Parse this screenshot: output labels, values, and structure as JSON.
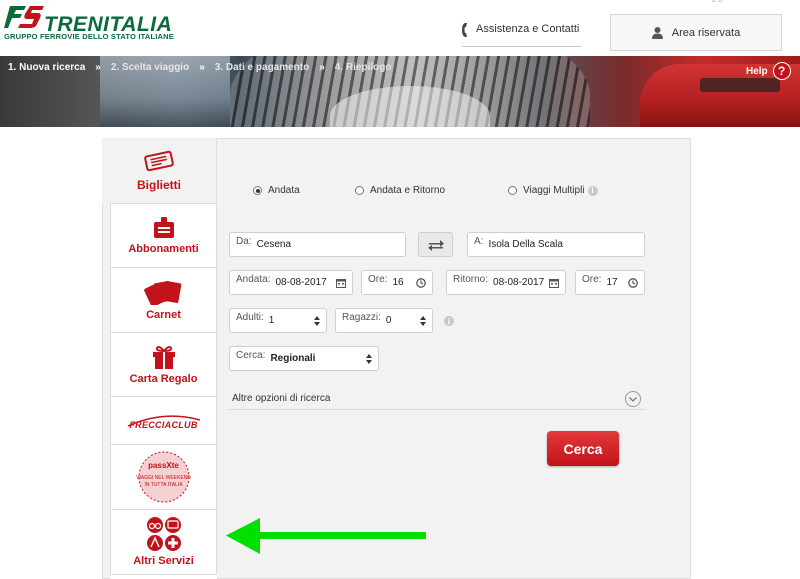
{
  "header": {
    "brand": "TRENITALIA",
    "brand_sub": "GRUPPO FERROVIE DELLO STATO ITALIANE",
    "assist_label": "Assistenza e Contatti",
    "area_label": "Area riservata"
  },
  "steps": [
    {
      "label": "1. Nuova ricerca"
    },
    {
      "label": "2. Scelta viaggio"
    },
    {
      "label": "3. Dati e pagamento"
    },
    {
      "label": "4. Riepilogo"
    }
  ],
  "step_separator": "»",
  "help_label": "Help",
  "help_icon": "?",
  "tabs": {
    "biglietti": "Biglietti",
    "abbonamenti": "Abbonamenti",
    "carnet": "Carnet",
    "carta_regalo": "Carta Regalo",
    "frecciaclub": "FRECCIACLUB",
    "passxte_title": "passXte",
    "passxte_sub": "VIAGGI NEL WEEKEND IN TUTTA ITALIA",
    "altri_servizi": "Altri Servizi"
  },
  "trip_type": {
    "options": [
      "Andata",
      "Andata e Ritorno",
      "Viaggi Multipli"
    ],
    "selected": "Andata"
  },
  "form": {
    "from_label": "Da:",
    "from_value": "Cesena",
    "to_label": "A:",
    "to_value": "Isola Della Scala",
    "andata_label": "Andata:",
    "andata_value": "08-08-2017",
    "ore1_label": "Ore:",
    "ore1_value": "16",
    "ritorno_label": "Ritorno:",
    "ritorno_value": "08-08-2017",
    "ore2_label": "Ore:",
    "ore2_value": "17",
    "adulti_label": "Adulti:",
    "adulti_value": "1",
    "ragazzi_label": "Ragazzi:",
    "ragazzi_value": "0",
    "cerca_label": "Cerca:",
    "cerca_value": "Regionali",
    "more_options": "Altre opzioni di ricerca",
    "submit": "Cerca"
  },
  "colors": {
    "brand_red": "#c2121a",
    "brand_green": "#0a6b3a",
    "annotation_arrow": "#00e000"
  }
}
